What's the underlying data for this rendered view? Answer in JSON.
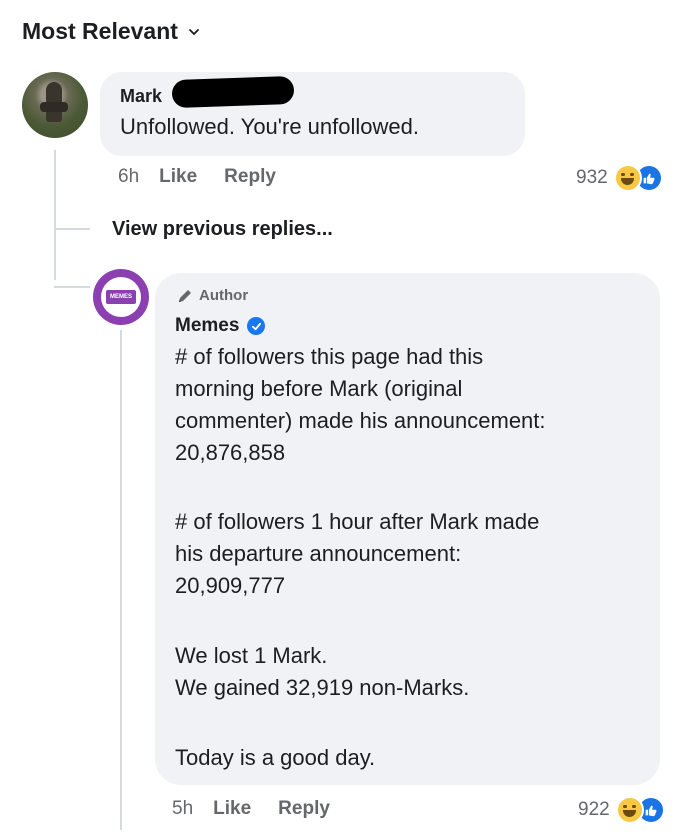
{
  "sort": {
    "label": "Most Relevant",
    "icon": "chevron-down-icon"
  },
  "comment": {
    "author": "Mark",
    "text": "Unfollowed.  You're unfollowed.",
    "time": "6h",
    "like_label": "Like",
    "reply_label": "Reply",
    "reaction_count": "932",
    "reactions": [
      "haha-icon",
      "like-icon"
    ]
  },
  "view_previous": "View previous replies...",
  "reply": {
    "badge": "Author",
    "author": "Memes",
    "avatar_text": "MEMES",
    "paragraphs": [
      [
        "# of followers this page had this",
        "morning before Mark (original",
        "commenter) made his announcement:",
        "20,876,858"
      ],
      [
        "# of followers 1 hour after Mark made",
        "his departure announcement:",
        "20,909,777"
      ],
      [
        "We lost 1 Mark.",
        "We gained 32,919 non-Marks."
      ],
      [
        "Today is a good day."
      ]
    ],
    "time": "5h",
    "like_label": "Like",
    "reply_label": "Reply",
    "reaction_count": "922",
    "reactions": [
      "haha-icon",
      "like-icon"
    ]
  },
  "colors": {
    "bubble": "#f0f2f5",
    "meta_text": "#65676b",
    "verified": "#1877f2",
    "memes_purple": "#8b3fb0"
  }
}
